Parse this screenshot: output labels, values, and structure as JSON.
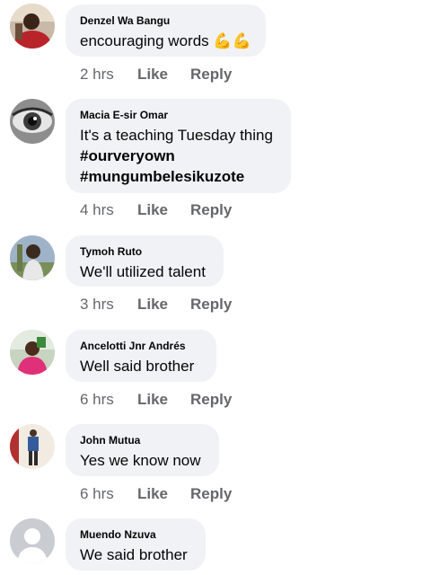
{
  "comments": [
    {
      "author": "Denzel Wa Bangu",
      "text": "encouraging words 💪💪",
      "time": "2 hrs",
      "like": "Like",
      "reply": "Reply",
      "avatar_icon": "person-red-shirt-avatar"
    },
    {
      "author": "Macia E-sir Omar",
      "line1": "It's a teaching Tuesday thing",
      "line2": "#ourveryown",
      "line3": "#mungumbelesikuzote",
      "time": "4 hrs",
      "like": "Like",
      "reply": "Reply",
      "avatar_icon": "eye-avatar"
    },
    {
      "author": "Tymoh Ruto",
      "text": "We'll utilized talent",
      "time": "3 hrs",
      "like": "Like",
      "reply": "Reply",
      "avatar_icon": "person-outdoor-avatar"
    },
    {
      "author": "Ancelotti Jnr Andrés",
      "text": "Well said brother",
      "time": "6 hrs",
      "like": "Like",
      "reply": "Reply",
      "avatar_icon": "person-pink-shirt-avatar"
    },
    {
      "author": "John Mutua",
      "text": "Yes we know now",
      "time": "6 hrs",
      "like": "Like",
      "reply": "Reply",
      "avatar_icon": "person-standing-avatar"
    },
    {
      "author": "Muendo Nzuva",
      "text": "We said brother",
      "avatar_icon": "default-user-avatar"
    }
  ]
}
